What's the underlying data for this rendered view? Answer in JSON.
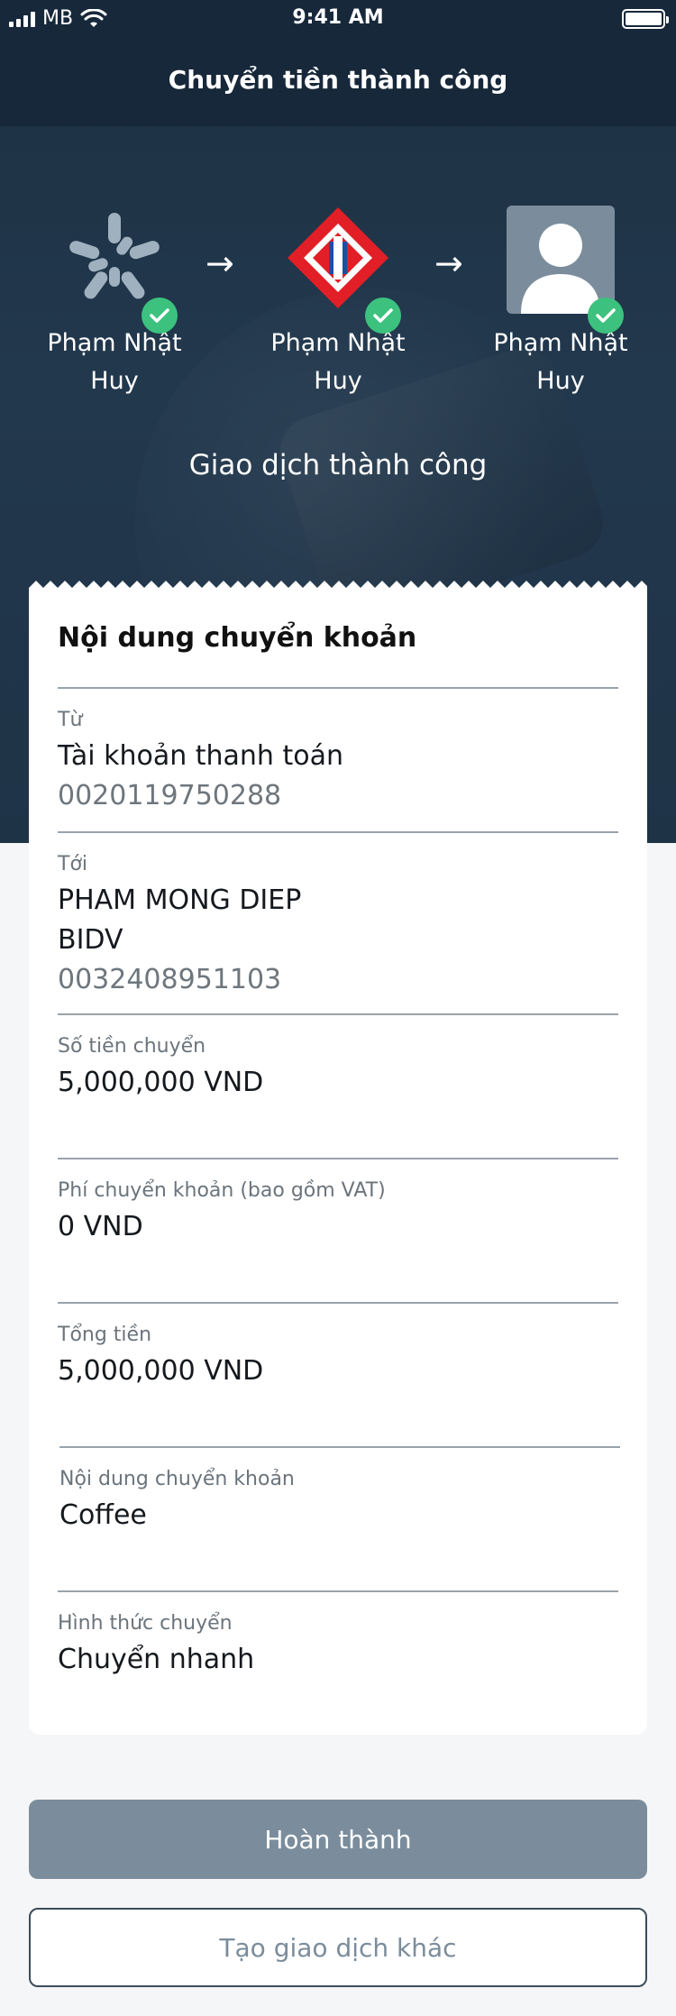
{
  "status_bar": {
    "carrier": "MB",
    "time": "9:41 AM"
  },
  "header": {
    "title": "Chuyển tiền thành công"
  },
  "flow": {
    "nodes": [
      {
        "name": "Phạm Nhật Huy",
        "icon": "mb-bank-logo-icon"
      },
      {
        "name": "Phạm Nhật Huy",
        "icon": "bidv-logo-icon"
      },
      {
        "name": "Phạm Nhật Huy",
        "icon": "user-avatar-icon"
      }
    ],
    "arrow_icon": "arrow-right-icon",
    "check_icon": "check-icon",
    "status_text": "Giao dịch thành công"
  },
  "details": {
    "title": "Nội dung chuyển khoản",
    "from": {
      "label": "Từ",
      "value": "Tài khoản thanh toán",
      "account": "0020119750288"
    },
    "to": {
      "label": "Tới",
      "name": "PHAM MONG DIEP",
      "bank": "BIDV",
      "account": "0032408951103"
    },
    "amount": {
      "label": "Số tiền chuyển",
      "value": "5,000,000 VND"
    },
    "fee": {
      "label": "Phí chuyển khoản (bao gồm VAT)",
      "value": "0 VND"
    },
    "total": {
      "label": "Tổng tiền",
      "value": "5,000,000 VND"
    },
    "content": {
      "label": "Nội dung chuyển khoản",
      "value": "Coffee"
    },
    "method": {
      "label": "Hình thức chuyển",
      "value": "Chuyển nhanh"
    }
  },
  "actions": {
    "done_label": "Hoàn thành",
    "new_transaction_label": "Tạo giao dịch khác"
  },
  "colors": {
    "header_bg": "#17283a",
    "hero_bg": "#22384d",
    "success_green": "#3cc27e",
    "bidv_red": "#e21f26",
    "primary_button": "#7b8d9c"
  }
}
